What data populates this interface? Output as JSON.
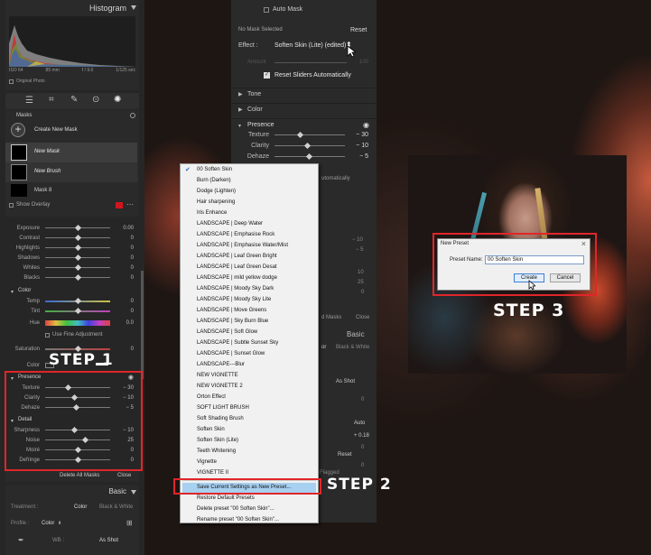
{
  "left": {
    "histogram_title": "Histogram",
    "histogram_info": [
      "ISO 64",
      "85 mm",
      "f / 9.0",
      "1/125 sec"
    ],
    "original_photo": "Original Photo",
    "masks_title": "Masks",
    "create_new_mask": "Create New Mask",
    "mask_items": [
      "New Mask",
      "New Brush",
      "Mask 8"
    ],
    "show_overlay": "Show Overlay",
    "light_sliders": [
      {
        "label": "Exposure",
        "value": "0.00"
      },
      {
        "label": "Contrast",
        "value": "0"
      },
      {
        "label": "Highlights",
        "value": "0"
      },
      {
        "label": "Shadows",
        "value": "0"
      },
      {
        "label": "Whites",
        "value": "0"
      },
      {
        "label": "Blacks",
        "value": "0"
      }
    ],
    "color_section": "Color",
    "color_sliders": [
      {
        "label": "Temp",
        "value": "0"
      },
      {
        "label": "Tint",
        "value": "0"
      },
      {
        "label": "Hue",
        "value": "0.0"
      }
    ],
    "use_fine_adjustment": "Use Fine Adjustment",
    "saturation_label": "Saturation",
    "saturation_value": "0",
    "color_label": "Color",
    "presence_section": "Presence",
    "presence_sliders": [
      {
        "label": "Texture",
        "value": "− 30"
      },
      {
        "label": "Clarity",
        "value": "− 10"
      },
      {
        "label": "Dehaze",
        "value": "− 5"
      }
    ],
    "detail_section": "Detail",
    "detail_sliders": [
      {
        "label": "Sharpness",
        "value": "− 10"
      },
      {
        "label": "Noise",
        "value": "25"
      },
      {
        "label": "Moiré",
        "value": "0"
      },
      {
        "label": "Defringe",
        "value": "0"
      }
    ],
    "delete_all_masks": "Delete All Masks",
    "close": "Close",
    "basic_title": "Basic",
    "treatment_label": "Treatment :",
    "treatment_color": "Color",
    "treatment_bw": "Black & White",
    "profile_label": "Profile :",
    "profile_value": "Color",
    "wb_label": "WB :",
    "wb_value": "As Shot"
  },
  "mid": {
    "auto_mask": "Auto Mask",
    "no_mask_selected": "No Mask Selected",
    "reset": "Reset",
    "effect_label": "Effect :",
    "effect_value": "Soften Skin (Lite) (edited)",
    "amount_label": "Amount",
    "amount_value": "100",
    "reset_sliders_auto": "Reset Sliders Automatically",
    "tone_section": "Tone",
    "color_section": "Color",
    "presence_section": "Presence",
    "presence_sliders": [
      {
        "label": "Texture",
        "value": "− 30"
      },
      {
        "label": "Clarity",
        "value": "− 10"
      },
      {
        "label": "Dehaze",
        "value": "− 5"
      }
    ],
    "fragments": [
      "utomatically",
      "− 10",
      "− 5",
      "10",
      "25",
      "0",
      "d Masks",
      "Close",
      "Basic",
      "or",
      "Black & White",
      "As Shot",
      "0",
      "Auto",
      "+ 0.18",
      "0",
      "0",
      "Reset",
      "Flagged"
    ]
  },
  "menu": {
    "items": [
      "00 Soften Skin",
      "Burn (Darken)",
      "Dodge (Lighten)",
      "Hair sharpening",
      "Iris Enhance",
      "LANDSCAPE | Deep Water",
      "LANDSCAPE | Emphasise Rock",
      "LANDSCAPE | Emphasise Water/Mist",
      "LANDSCAPE | Leaf Green Bright",
      "LANDSCAPE | Leaf Green Desat",
      "LANDSCAPE | mild yellow dodge",
      "LANDSCAPE | Moody Sky Dark",
      "LANDSCAPE | Moody Sky Lite",
      "LANDSCAPE | Move Greens",
      "LANDSCAPE | Sky Burn Blue",
      "LANDSCAPE | Soft Glow",
      "LANDSCAPE | Subtle Sunset Sky",
      "LANDSCAPE | Sunset Glow",
      "LANDSCAPE---Blur",
      "NEW VIGNETTE",
      "NEW VIGNETTE 2",
      "Orton Effect",
      "SOFT LIGHT BRUSH",
      "Soft Shading Brush",
      "Soften Skin",
      "Soften Skin (Lite)",
      "Teeth Whitening",
      "Vignette",
      "VIGNETTE II"
    ],
    "actions": [
      "Save Current Settings as New Preset...",
      "Restore Default Presets",
      "Delete preset \"00 Soften Skin\"...",
      "Rename preset \"00 Soften Skin\"..."
    ]
  },
  "dialog": {
    "title": "New Preset",
    "close_glyph": "×",
    "name_label": "Preset Name:",
    "name_value": "00 Soften Skin",
    "create": "Create",
    "cancel": "Cancel"
  },
  "steps": {
    "step1": "STEP 1",
    "step2": "STEP 2",
    "step3": "STEP 3"
  },
  "colors": {
    "accent_red": "#e0262a",
    "overlay_swatch": "#d0161d",
    "menu_highlight": "#a8d0f0",
    "check_blue": "#2b6cc4"
  }
}
